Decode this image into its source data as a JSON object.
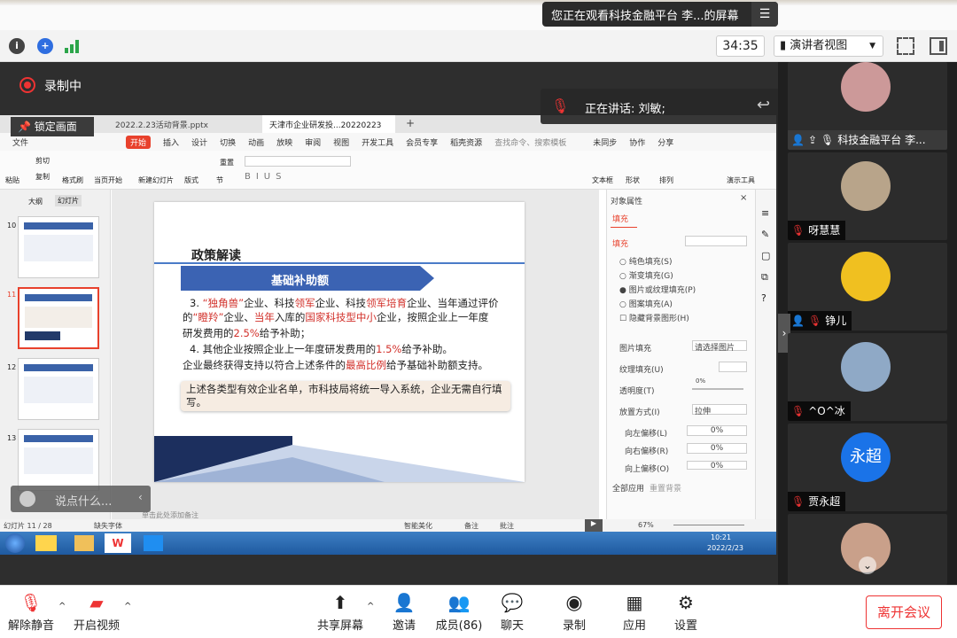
{
  "share_banner": {
    "text": "您正在观看科技金融平台 李...的屏幕",
    "menu_icon": "menu-icon"
  },
  "infobar": {
    "timer": "34:35",
    "view_mode": "演讲者视图"
  },
  "overlay": {
    "recording": "录制中",
    "lock_screen": "锁定画面",
    "speaking": "正在讲话: 刘敏;",
    "chat_placeholder": "说点什么..."
  },
  "wps": {
    "tabs": [
      "2022.2.23活动背景.pptx",
      "天津市企业研发投...20220223"
    ],
    "menu": [
      "文件",
      "开始",
      "插入",
      "设计",
      "切换",
      "动画",
      "放映",
      "审阅",
      "视图",
      "开发工具",
      "会员专享",
      "稻壳资源",
      "查找命令、搜索模板",
      "未同步",
      "协作",
      "分享"
    ],
    "ribbon": [
      "粘贴",
      "剪切",
      "复制",
      "格式刷",
      "当页开始",
      "新建幻灯片",
      "版式",
      "节",
      "重置",
      "文本框",
      "形状",
      "排列",
      "演示工具"
    ],
    "thumb_tabs": [
      "大纲",
      "幻灯片"
    ],
    "thumb_numbers": [
      "10",
      "11",
      "12",
      "13"
    ],
    "slide": {
      "title": "政策解读",
      "banner": "基础补助额",
      "p1_a": "3. ",
      "p1_red1": "“独角兽”",
      "p1_b": "企业、科技",
      "p1_red2": "领军",
      "p1_c": "企业、科技",
      "p1_red3": "领军培育",
      "p1_d": "企业、当年通过评价",
      "p2_a": "的",
      "p2_red1": "“瞪羚”",
      "p2_b": "企业、",
      "p2_red2": "当年",
      "p2_c": "入库的",
      "p2_red3": "国家科技型中小",
      "p2_d": "企业，按照企业上一年度",
      "p3_a": "研发费用的",
      "p3_red": "2.5%",
      "p3_b": "给予补助；",
      "p4_a": "4. 其他企业按照企业上一年度研发费用的",
      "p4_red": "1.5%",
      "p4_b": "给予补助。",
      "p5_a": "企业最终获得支持以符合上述条件的",
      "p5_red": "最高比例",
      "p5_b": "给予基础补助额支持。",
      "note": "上述各类型有效企业名单，市科技局将统一导入系统，企业无需自行填写。"
    },
    "panel": {
      "title": "对象属性",
      "tab": "填充",
      "section": "填充",
      "options": [
        "纯色填充(S)",
        "渐变填充(G)",
        "图片或纹理填充(P)",
        "图案填充(A)",
        "隐藏背景图形(H)"
      ],
      "rows": [
        {
          "label": "图片填充",
          "value": "请选择图片"
        },
        {
          "label": "纹理填充(U)",
          "value": ""
        },
        {
          "label": "透明度(T)",
          "value": "0%"
        },
        {
          "label": "放置方式(I)",
          "value": "拉伸"
        },
        {
          "label": "向左偏移(L)",
          "value": "0%"
        },
        {
          "label": "向右偏移(R)",
          "value": "0%"
        },
        {
          "label": "向上偏移(O)",
          "value": "0%"
        }
      ],
      "apply_all": "全部应用",
      "reset_bg": "重置背景"
    },
    "status": {
      "slide_count": "幻灯片 11 / 28",
      "font": "缺失字体",
      "note_hint": "单击此处添加备注",
      "beautify": "智能美化",
      "notes": "备注",
      "comments": "批注",
      "zoom": "67%"
    },
    "taskbar": {
      "time": "10:21",
      "date": "2022/2/23"
    }
  },
  "gallery": [
    {
      "name": "科技金融平台 李...",
      "avatar": "#c99"
    },
    {
      "name": "呀慧慧",
      "avatar": "#b8a48a"
    },
    {
      "name": "铮儿",
      "avatar": "#f0c020"
    },
    {
      "name": "^O^冰",
      "avatar": "#8fa9c6"
    },
    {
      "name": "贾永超",
      "avatar": "#1a73e8",
      "initials": "永超"
    }
  ],
  "bottombar": [
    "解除静音",
    "开启视频",
    "共享屏幕",
    "邀请",
    "成员(86)",
    "聊天",
    "录制",
    "应用",
    "设置"
  ],
  "leave": "离开会议"
}
